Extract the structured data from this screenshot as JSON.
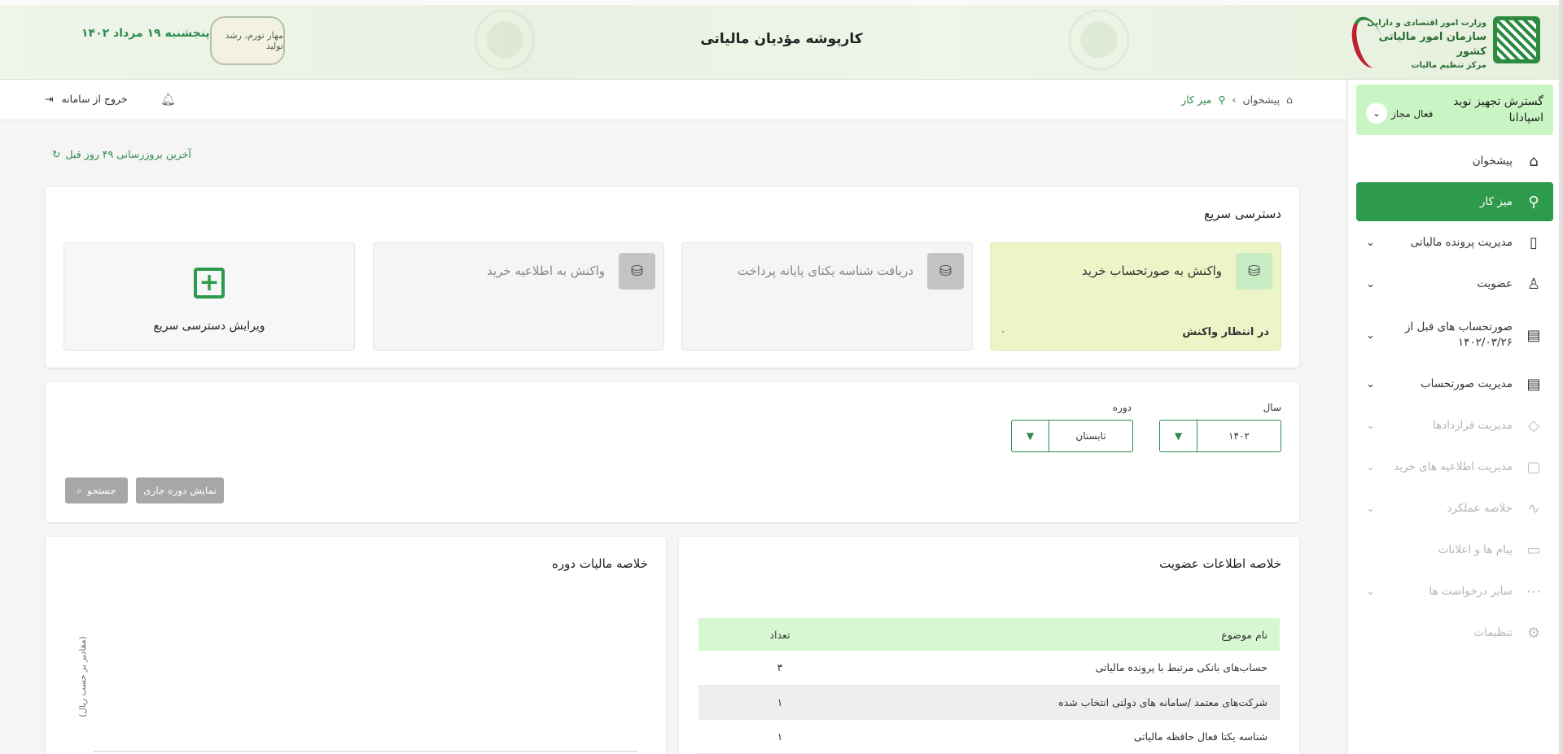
{
  "header": {
    "title": "کارپوشه مؤدیان مالیاتی",
    "date": "پنجشنبه ۱۹ مرداد ۱۴۰۲",
    "logo_lines": [
      "وزارت امور اقتصادی و دارایی",
      "سازمان امور مالیاتی کشور",
      "مرکز تنظیم مالیات"
    ],
    "slogan": "مهار تورم، رشد تولید"
  },
  "company": {
    "name": "گسترش تجهیز نوید اسپادانا",
    "role": "فعال مجاز"
  },
  "sidebar": {
    "items": [
      {
        "label": "پیشخوان",
        "icon": "home-icon",
        "state": "normal"
      },
      {
        "label": "میز کار",
        "icon": "workspace-icon",
        "state": "active"
      },
      {
        "label": "مدیریت پرونده مالیاتی",
        "icon": "file-icon",
        "state": "normal",
        "expandable": true
      },
      {
        "label": "عضویت",
        "icon": "user-icon",
        "state": "normal",
        "expandable": true
      },
      {
        "label": "صورتحساب های قبل از ۱۴۰۲/۰۳/۲۶",
        "icon": "receipt-icon",
        "state": "normal",
        "expandable": true
      },
      {
        "label": "مدیریت صورتحساب",
        "icon": "invoice-icon",
        "state": "normal",
        "expandable": true
      },
      {
        "label": "مدیریت قراردادها",
        "icon": "contract-icon",
        "state": "disabled",
        "expandable": true
      },
      {
        "label": "مدیریت اطلاعیه های خرید",
        "icon": "bag-icon",
        "state": "disabled",
        "expandable": true
      },
      {
        "label": "خلاصه عملکرد",
        "icon": "chart-icon",
        "state": "disabled",
        "expandable": true
      },
      {
        "label": "پیام ها و اعلانات",
        "icon": "message-icon",
        "state": "disabled"
      },
      {
        "label": "سایر درخواست ها",
        "icon": "more-icon",
        "state": "disabled",
        "expandable": true
      },
      {
        "label": "تنظیمات",
        "icon": "gear-icon",
        "state": "disabled"
      }
    ]
  },
  "breadcrumb": {
    "home": "پیشخوان",
    "current": "میز کار"
  },
  "topbar": {
    "logout": "خروج از سامانه"
  },
  "last_update": "آخرین بروزرسانی ۴۹ روز قبل",
  "quick_access": {
    "title": "دسترسی سریع",
    "items": [
      {
        "label": "واکنش به صورتحساب خرید",
        "status": "در انتظار واکنش",
        "count": "۰"
      },
      {
        "label": "دریافت شناسه یکتای پایانه پرداخت"
      },
      {
        "label": "واکنش به اطلاعیه خرید"
      }
    ],
    "edit_label": "ویرایش دسترسی سریع"
  },
  "filters": {
    "year_label": "سال",
    "year_value": "۱۴۰۲",
    "period_label": "دوره",
    "period_value": "تابستان",
    "search_button": "جستجو",
    "current_period_button": "نمایش دوره جاری"
  },
  "membership": {
    "title": "خلاصه اطلاعات عضویت",
    "columns": [
      "نام موضوع",
      "تعداد"
    ],
    "rows": [
      {
        "name": "حساب‌های بانکی مرتبط با پرونده مالیاتی",
        "count": "۳"
      },
      {
        "name": "شرکت‌های معتمد /سامانه های دولتی انتخاب شده",
        "count": "۱"
      },
      {
        "name": "شناسه یکتا فعال حافظه مالیاتی",
        "count": "۱"
      }
    ]
  },
  "tax_summary": {
    "title": "خلاصه مالیات دوره",
    "ylabel": "(مقادیر بر حسب ریال)"
  },
  "colors": {
    "primary": "#2e9a4c",
    "accent_light": "#c9f5c4",
    "qa_highlight": "#ecf5c8",
    "table_header": "#d6f7d2"
  }
}
